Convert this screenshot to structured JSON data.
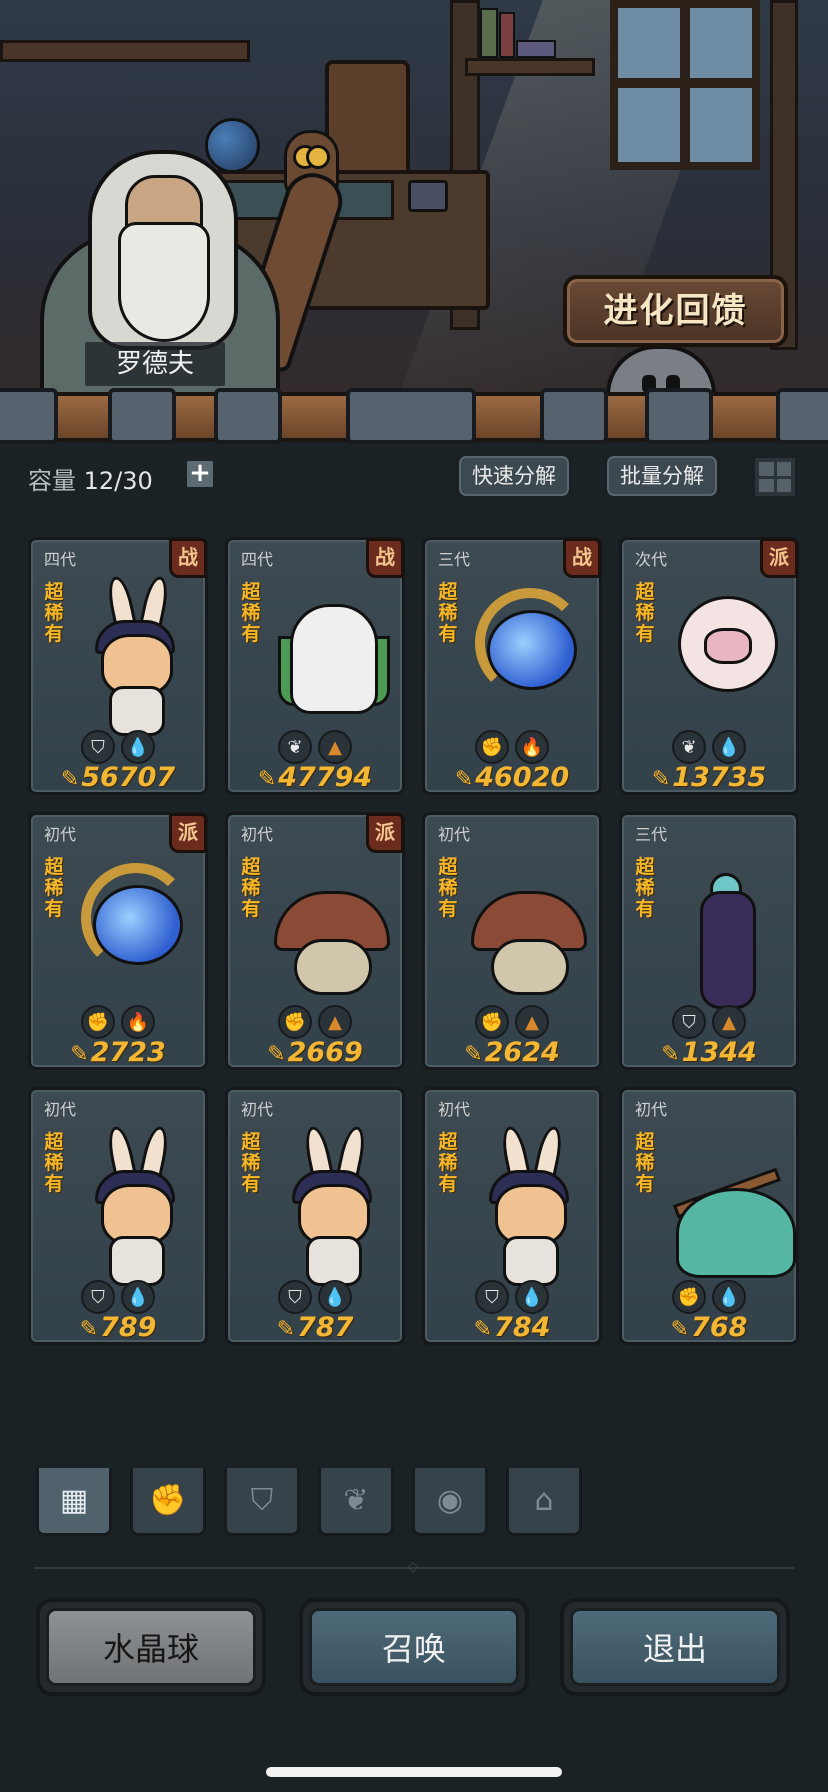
{
  "scene": {
    "npc_name": "罗德夫",
    "evolution_button": "进化回馈"
  },
  "toolbar": {
    "capacity_label": "容量",
    "capacity_value": "12/30",
    "add_icon": "plus-icon",
    "quick_decompose": "快速分解",
    "batch_decompose": "批量分解",
    "layout_icon": "grid-icon"
  },
  "cards": [
    {
      "generation": "四代",
      "faction": "战",
      "rarity": "超稀有",
      "types": [
        "shield-icon",
        "water-icon"
      ],
      "power": "56707",
      "character": "bunny"
    },
    {
      "generation": "四代",
      "faction": "战",
      "rarity": "超稀有",
      "types": [
        "leaf-icon",
        "earth-icon"
      ],
      "power": "47794",
      "character": "owl-warrior"
    },
    {
      "generation": "三代",
      "faction": "战",
      "rarity": "超稀有",
      "types": [
        "fist-icon",
        "fire-icon"
      ],
      "power": "46020",
      "character": "spirit"
    },
    {
      "generation": "次代",
      "faction": "派",
      "rarity": "超稀有",
      "types": [
        "leaf-icon",
        "water-icon"
      ],
      "power": "13735",
      "character": "puff"
    },
    {
      "generation": "初代",
      "faction": "派",
      "rarity": "超稀有",
      "types": [
        "fist-icon",
        "fire-icon"
      ],
      "power": "2723",
      "character": "spirit"
    },
    {
      "generation": "初代",
      "faction": "派",
      "rarity": "超稀有",
      "types": [
        "fist-icon",
        "earth-icon"
      ],
      "power": "2669",
      "character": "mushroom"
    },
    {
      "generation": "初代",
      "faction": "",
      "rarity": "超稀有",
      "types": [
        "fist-icon",
        "earth-icon"
      ],
      "power": "2624",
      "character": "mushroom"
    },
    {
      "generation": "三代",
      "faction": "",
      "rarity": "超稀有",
      "types": [
        "shield-icon",
        "earth-icon"
      ],
      "power": "1344",
      "character": "dark"
    },
    {
      "generation": "初代",
      "faction": "",
      "rarity": "超稀有",
      "types": [
        "shield-icon",
        "water-icon"
      ],
      "power": "789",
      "character": "bunny"
    },
    {
      "generation": "初代",
      "faction": "",
      "rarity": "超稀有",
      "types": [
        "shield-icon",
        "water-icon"
      ],
      "power": "787",
      "character": "bunny"
    },
    {
      "generation": "初代",
      "faction": "",
      "rarity": "超稀有",
      "types": [
        "shield-icon",
        "water-icon"
      ],
      "power": "784",
      "character": "bunny"
    },
    {
      "generation": "初代",
      "faction": "",
      "rarity": "超稀有",
      "types": [
        "fist-icon",
        "water-icon"
      ],
      "power": "768",
      "character": "slime"
    }
  ],
  "tabs": [
    {
      "icon": "all-blocks-icon",
      "active": true
    },
    {
      "icon": "fist-icon",
      "active": false
    },
    {
      "icon": "shield-wings-icon",
      "active": false
    },
    {
      "icon": "sprout-icon",
      "active": false
    },
    {
      "icon": "spirit-orb-icon",
      "active": false
    },
    {
      "icon": "shrine-icon",
      "active": false
    }
  ],
  "buttons": {
    "crystal_ball": "水晶球",
    "summon": "召唤",
    "exit": "退出"
  },
  "colors": {
    "power_text": "#f4b734",
    "rarity_text": "#f5b627",
    "faction_badge": "#6b2c1e",
    "panel_bg": "#1b2226"
  }
}
